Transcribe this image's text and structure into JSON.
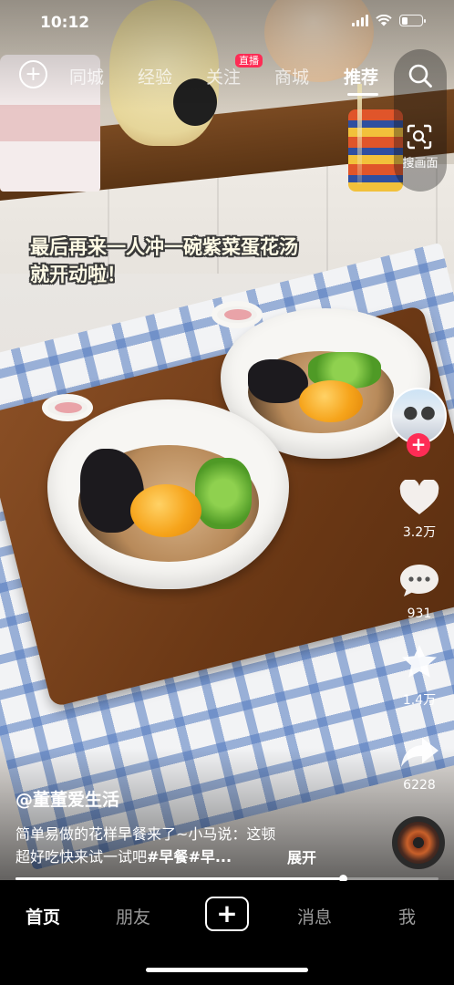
{
  "status_bar": {
    "time": "10:12"
  },
  "top_nav": {
    "tabs": [
      {
        "label": "同城",
        "active": false
      },
      {
        "label": "经验",
        "active": false
      },
      {
        "label": "关注",
        "active": false,
        "badge": "直播"
      },
      {
        "label": "商城",
        "active": false
      },
      {
        "label": "推荐",
        "active": true
      }
    ],
    "search_icon": "search-icon",
    "scan_label": "搜画面"
  },
  "video": {
    "caption_line1": "最后再来一人冲一碗紫菜蛋花汤",
    "caption_line2": "就开动啦！",
    "progress": 0.775
  },
  "right_rail": {
    "like_count": "3.2万",
    "comment_count": "931",
    "favorite_count": "1.4万",
    "share_count": "6228"
  },
  "post": {
    "author": "@董董爱生活",
    "desc_line1": "简单易做的花样早餐来了~小马说：这顿",
    "desc_line2_prefix": "超好吃快来试一试吧",
    "tag1": "#早餐",
    "tag2_truncated": "#早...",
    "expand_label": "展开"
  },
  "tab_bar": {
    "items": [
      {
        "label": "首页",
        "active": true
      },
      {
        "label": "朋友",
        "active": false
      },
      {
        "label": "消息",
        "active": false
      },
      {
        "label": "我",
        "active": false
      }
    ]
  },
  "colors": {
    "accent": "#fe2c55",
    "tabbar_bg": "#000000"
  }
}
